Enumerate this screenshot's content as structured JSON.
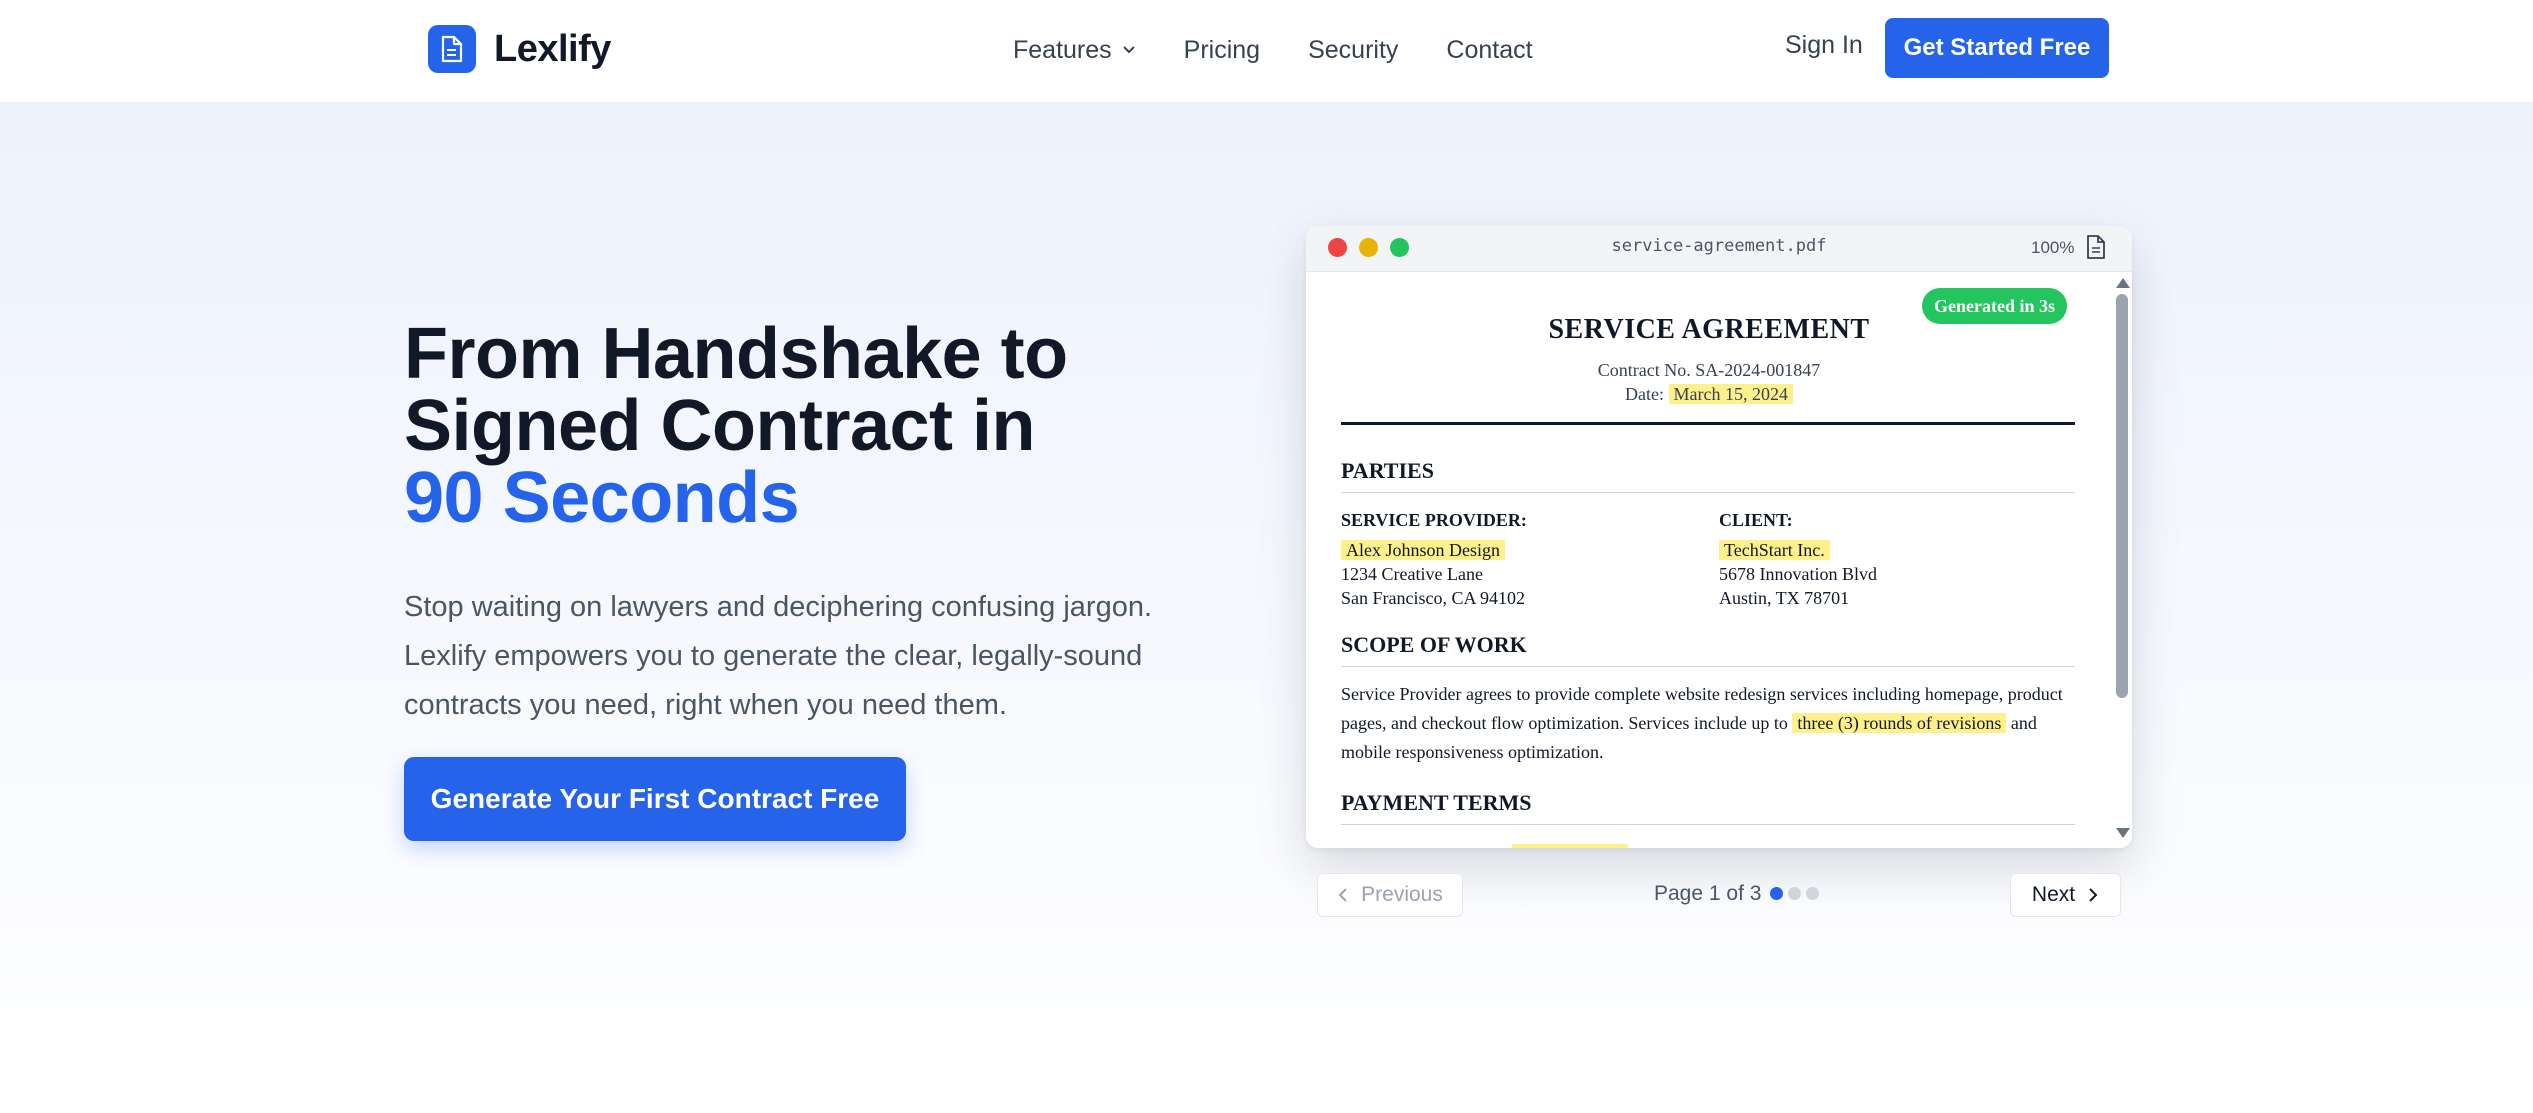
{
  "nav": {
    "brand": "Lexlify",
    "links": [
      "Features",
      "Pricing",
      "Security",
      "Contact"
    ],
    "sign_in": "Sign In",
    "cta": "Get Started Free"
  },
  "hero": {
    "headline_line1": "From Handshake to",
    "headline_line2": "Signed Contract in",
    "headline_accent": "90 Seconds",
    "subtext": "Stop waiting on lawyers and deciphering confusing jargon. Lexlify empowers you to generate the clear, legally-sound contracts you need, right when you need them.",
    "cta": "Generate Your First Contract Free"
  },
  "preview": {
    "filename": "service-agreement.pdf",
    "zoom": "100%",
    "badge": "Generated in 3s",
    "doc": {
      "title": "SERVICE AGREEMENT",
      "contract_no": "Contract No. SA-2024-001847",
      "date_label": "Date:",
      "date_value": "March 15, 2024",
      "parties_heading": "PARTIES",
      "provider_label": "SERVICE PROVIDER:",
      "provider_name": "Alex Johnson Design",
      "provider_addr1": "1234 Creative Lane",
      "provider_addr2": "San Francisco, CA 94102",
      "client_label": "CLIENT:",
      "client_name": "TechStart Inc.",
      "client_addr1": "5678 Innovation Blvd",
      "client_addr2": "Austin, TX 78701",
      "scope_heading": "SCOPE OF WORK",
      "scope_text_before": "Service Provider agrees to provide complete website redesign services including homepage, product pages, and checkout flow optimization. Services include up to",
      "scope_highlight": "three (3) rounds of revisions",
      "scope_text_after": "and mobile responsiveness optimization.",
      "payment_heading": "PAYMENT TERMS"
    },
    "pagination": {
      "prev": "Previous",
      "next": "Next",
      "page_label": "Page 1 of 3",
      "current_page": 1,
      "total_pages": 3
    }
  },
  "colors": {
    "brand": "#2563eb",
    "badge": "#22c55e",
    "highlight": "#fef08a"
  }
}
